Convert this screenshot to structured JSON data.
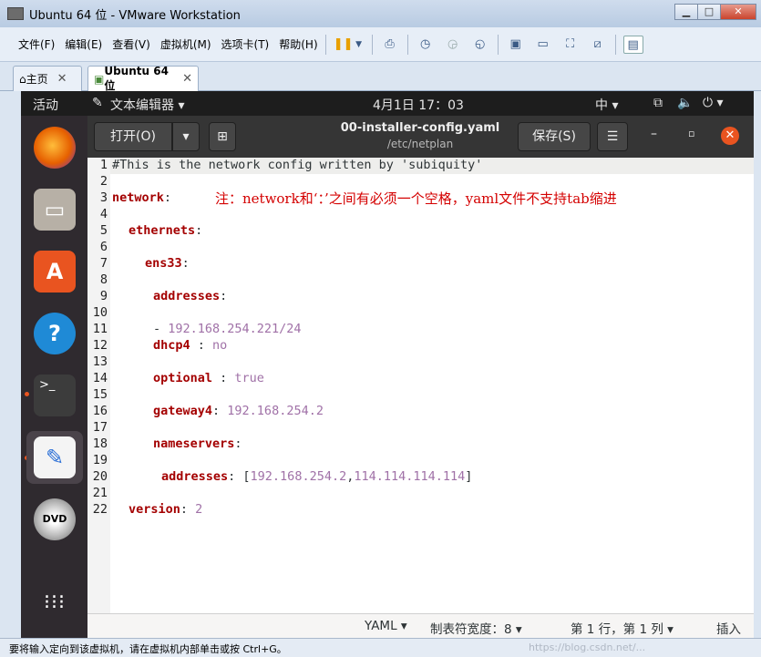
{
  "host": {
    "title": "Ubuntu 64 位 - VMware Workstation",
    "menus": [
      "文件(F)",
      "编辑(E)",
      "查看(V)",
      "虚拟机(M)",
      "选项卡(T)",
      "帮助(H)"
    ],
    "tabs": [
      {
        "label": "主页"
      },
      {
        "label": "Ubuntu 64 位"
      }
    ],
    "status_text": "要将输入定向到该虚拟机，请在虚拟机内部单击或按 Ctrl+G。",
    "watermark": "https://blog.csdn.net/..."
  },
  "guest": {
    "activities": "活动",
    "app_menu": "文本编辑器",
    "clock": "4月1日  17：03",
    "input_method": "中",
    "editor": {
      "open_label": "打开(O)",
      "file_name": "00-installer-config.yaml",
      "file_path": "/etc/netplan",
      "save_label": "保存(S)",
      "annotation": "注：network和‘：’之间有必须一个空格，yaml文件不支持tab缩进",
      "line_numbers": [
        "1",
        "2",
        "3",
        "4",
        "5",
        "6",
        "7",
        "8",
        "9",
        "10",
        "11",
        "12",
        "13",
        "14",
        "15",
        "16",
        "17",
        "18",
        "19",
        "20",
        "21",
        "22"
      ],
      "lines": {
        "l1": "#This is the network config written by 'subiquity'",
        "l3_key": "network",
        "l5_key": "ethernets",
        "l7_key": "ens33",
        "l9_key": "addresses",
        "l11_dash": "- ",
        "l11_val": "192.168.254.221/24",
        "l12_key": "dhcp4",
        "l12_val": "no",
        "l14_key": "optional",
        "l14_val": "true",
        "l16_key": "gateway4",
        "l16_val": "192.168.254.2",
        "l18_key": "nameservers",
        "l20_key": "addresses",
        "l20_val1": "192.168.254.2",
        "l20_val2": "114.114.114.114",
        "l22_key": "version",
        "l22_val": "2"
      },
      "status": {
        "language": "YAML",
        "tab_width": "制表符宽度：8",
        "position": "第 1 行，第 1 列",
        "mode": "插入"
      }
    }
  }
}
